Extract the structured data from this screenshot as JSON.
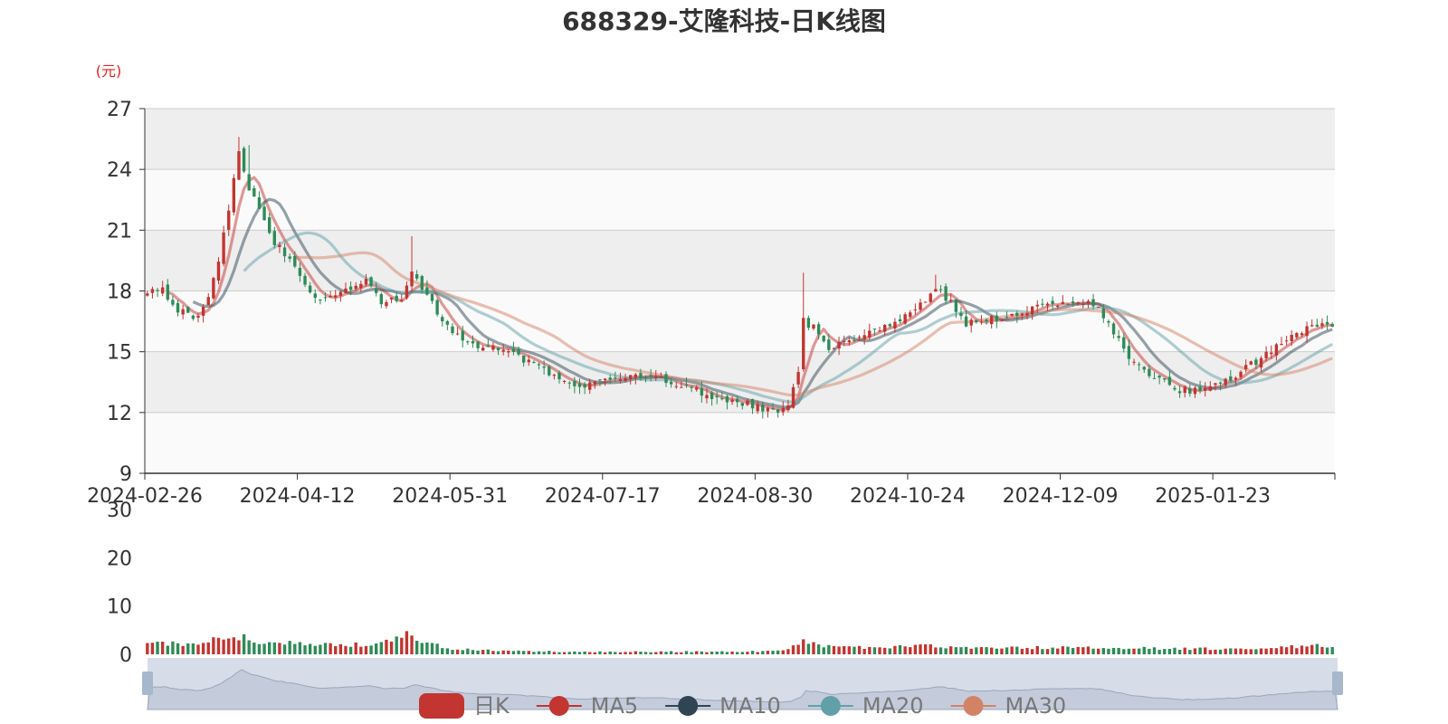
{
  "chart_data": {
    "type": "candlestick",
    "title": "688329-艾隆科技-日K线图",
    "unit_label": "(元)",
    "price_axis": {
      "ylim": [
        9,
        27
      ],
      "ticks": [
        "27",
        "24",
        "21",
        "18",
        "15",
        "12",
        "9"
      ]
    },
    "volume_axis": {
      "ylim": [
        0,
        30
      ],
      "ticks": [
        "30",
        "20",
        "10",
        "0"
      ]
    },
    "x_tick_labels": [
      "2024-02-26",
      "2024-04-12",
      "2024-05-31",
      "2024-07-17",
      "2024-08-30",
      "2024-10-24",
      "2024-12-09",
      "2025-01-23"
    ],
    "x_tick_indices": [
      0,
      30,
      60,
      90,
      120,
      150,
      180,
      210
    ],
    "grid": true,
    "legend": {
      "position": "bottom",
      "items": [
        {
          "name": "日K",
          "color": "#c23531"
        },
        {
          "name": "MA5",
          "color": "#c23531"
        },
        {
          "name": "MA10",
          "color": "#2f4554"
        },
        {
          "name": "MA20",
          "color": "#61a0a8"
        },
        {
          "name": "MA30",
          "color": "#d48265"
        }
      ]
    },
    "colors": {
      "up": "#c23531",
      "down": "#2e8b57",
      "grid": "#cccccc",
      "band": "#eeeeee",
      "axis": "#333333"
    },
    "anchors": [
      [
        0,
        17.8
      ],
      [
        3,
        18.2
      ],
      [
        5,
        17.2
      ],
      [
        8,
        16.9
      ],
      [
        10,
        16.7
      ],
      [
        11,
        17.1
      ],
      [
        12,
        17.6
      ],
      [
        14,
        19.6
      ],
      [
        16,
        22.0
      ],
      [
        18,
        25.0
      ],
      [
        20,
        23.0
      ],
      [
        22,
        22.0
      ],
      [
        24,
        20.7
      ],
      [
        28,
        19.6
      ],
      [
        32,
        18.0
      ],
      [
        34,
        17.6
      ],
      [
        37,
        17.8
      ],
      [
        40,
        18.2
      ],
      [
        43,
        18.6
      ],
      [
        46,
        17.3
      ],
      [
        50,
        17.7
      ],
      [
        52,
        18.9
      ],
      [
        55,
        17.7
      ],
      [
        58,
        16.6
      ],
      [
        62,
        15.5
      ],
      [
        66,
        15.2
      ],
      [
        70,
        15.2
      ],
      [
        75,
        14.5
      ],
      [
        80,
        13.8
      ],
      [
        85,
        13.3
      ],
      [
        90,
        13.7
      ],
      [
        95,
        13.9
      ],
      [
        100,
        13.7
      ],
      [
        105,
        13.4
      ],
      [
        110,
        12.9
      ],
      [
        115,
        12.6
      ],
      [
        120,
        12.3
      ],
      [
        124,
        12.0
      ],
      [
        126,
        12.5
      ],
      [
        128,
        14.0
      ],
      [
        129,
        16.5
      ],
      [
        131,
        16.2
      ],
      [
        134,
        15.2
      ],
      [
        139,
        15.6
      ],
      [
        144,
        16.1
      ],
      [
        148,
        16.6
      ],
      [
        152,
        17.3
      ],
      [
        155,
        18.2
      ],
      [
        158,
        17.4
      ],
      [
        161,
        16.4
      ],
      [
        166,
        16.6
      ],
      [
        172,
        17.0
      ],
      [
        178,
        17.3
      ],
      [
        183,
        17.6
      ],
      [
        187,
        17.1
      ],
      [
        190,
        16.0
      ],
      [
        194,
        14.4
      ],
      [
        199,
        13.6
      ],
      [
        203,
        13.1
      ],
      [
        207,
        13.1
      ],
      [
        211,
        13.4
      ],
      [
        216,
        14.2
      ],
      [
        221,
        15.0
      ],
      [
        226,
        16.0
      ],
      [
        230,
        16.2
      ],
      [
        233,
        16.3
      ]
    ],
    "volume_profile": [
      [
        0,
        2.6
      ],
      [
        2,
        3.0
      ],
      [
        4,
        2.2
      ],
      [
        8,
        2.3
      ],
      [
        11,
        2.3
      ],
      [
        14,
        3.2
      ],
      [
        17,
        3.6
      ],
      [
        19,
        3.4
      ],
      [
        22,
        2.8
      ],
      [
        28,
        2.6
      ],
      [
        32,
        2.2
      ],
      [
        40,
        2.0
      ],
      [
        45,
        2.0
      ],
      [
        52,
        4.2
      ],
      [
        55,
        2.5
      ],
      [
        60,
        1.2
      ],
      [
        70,
        0.7
      ],
      [
        90,
        0.5
      ],
      [
        120,
        0.6
      ],
      [
        126,
        1.0
      ],
      [
        129,
        2.7
      ],
      [
        133,
        1.6
      ],
      [
        140,
        1.4
      ],
      [
        150,
        1.6
      ],
      [
        154,
        1.8
      ],
      [
        160,
        1.4
      ],
      [
        180,
        1.4
      ],
      [
        200,
        1.2
      ],
      [
        220,
        1.1
      ],
      [
        228,
        1.8
      ],
      [
        233,
        1.6
      ]
    ],
    "seed": 688329
  }
}
